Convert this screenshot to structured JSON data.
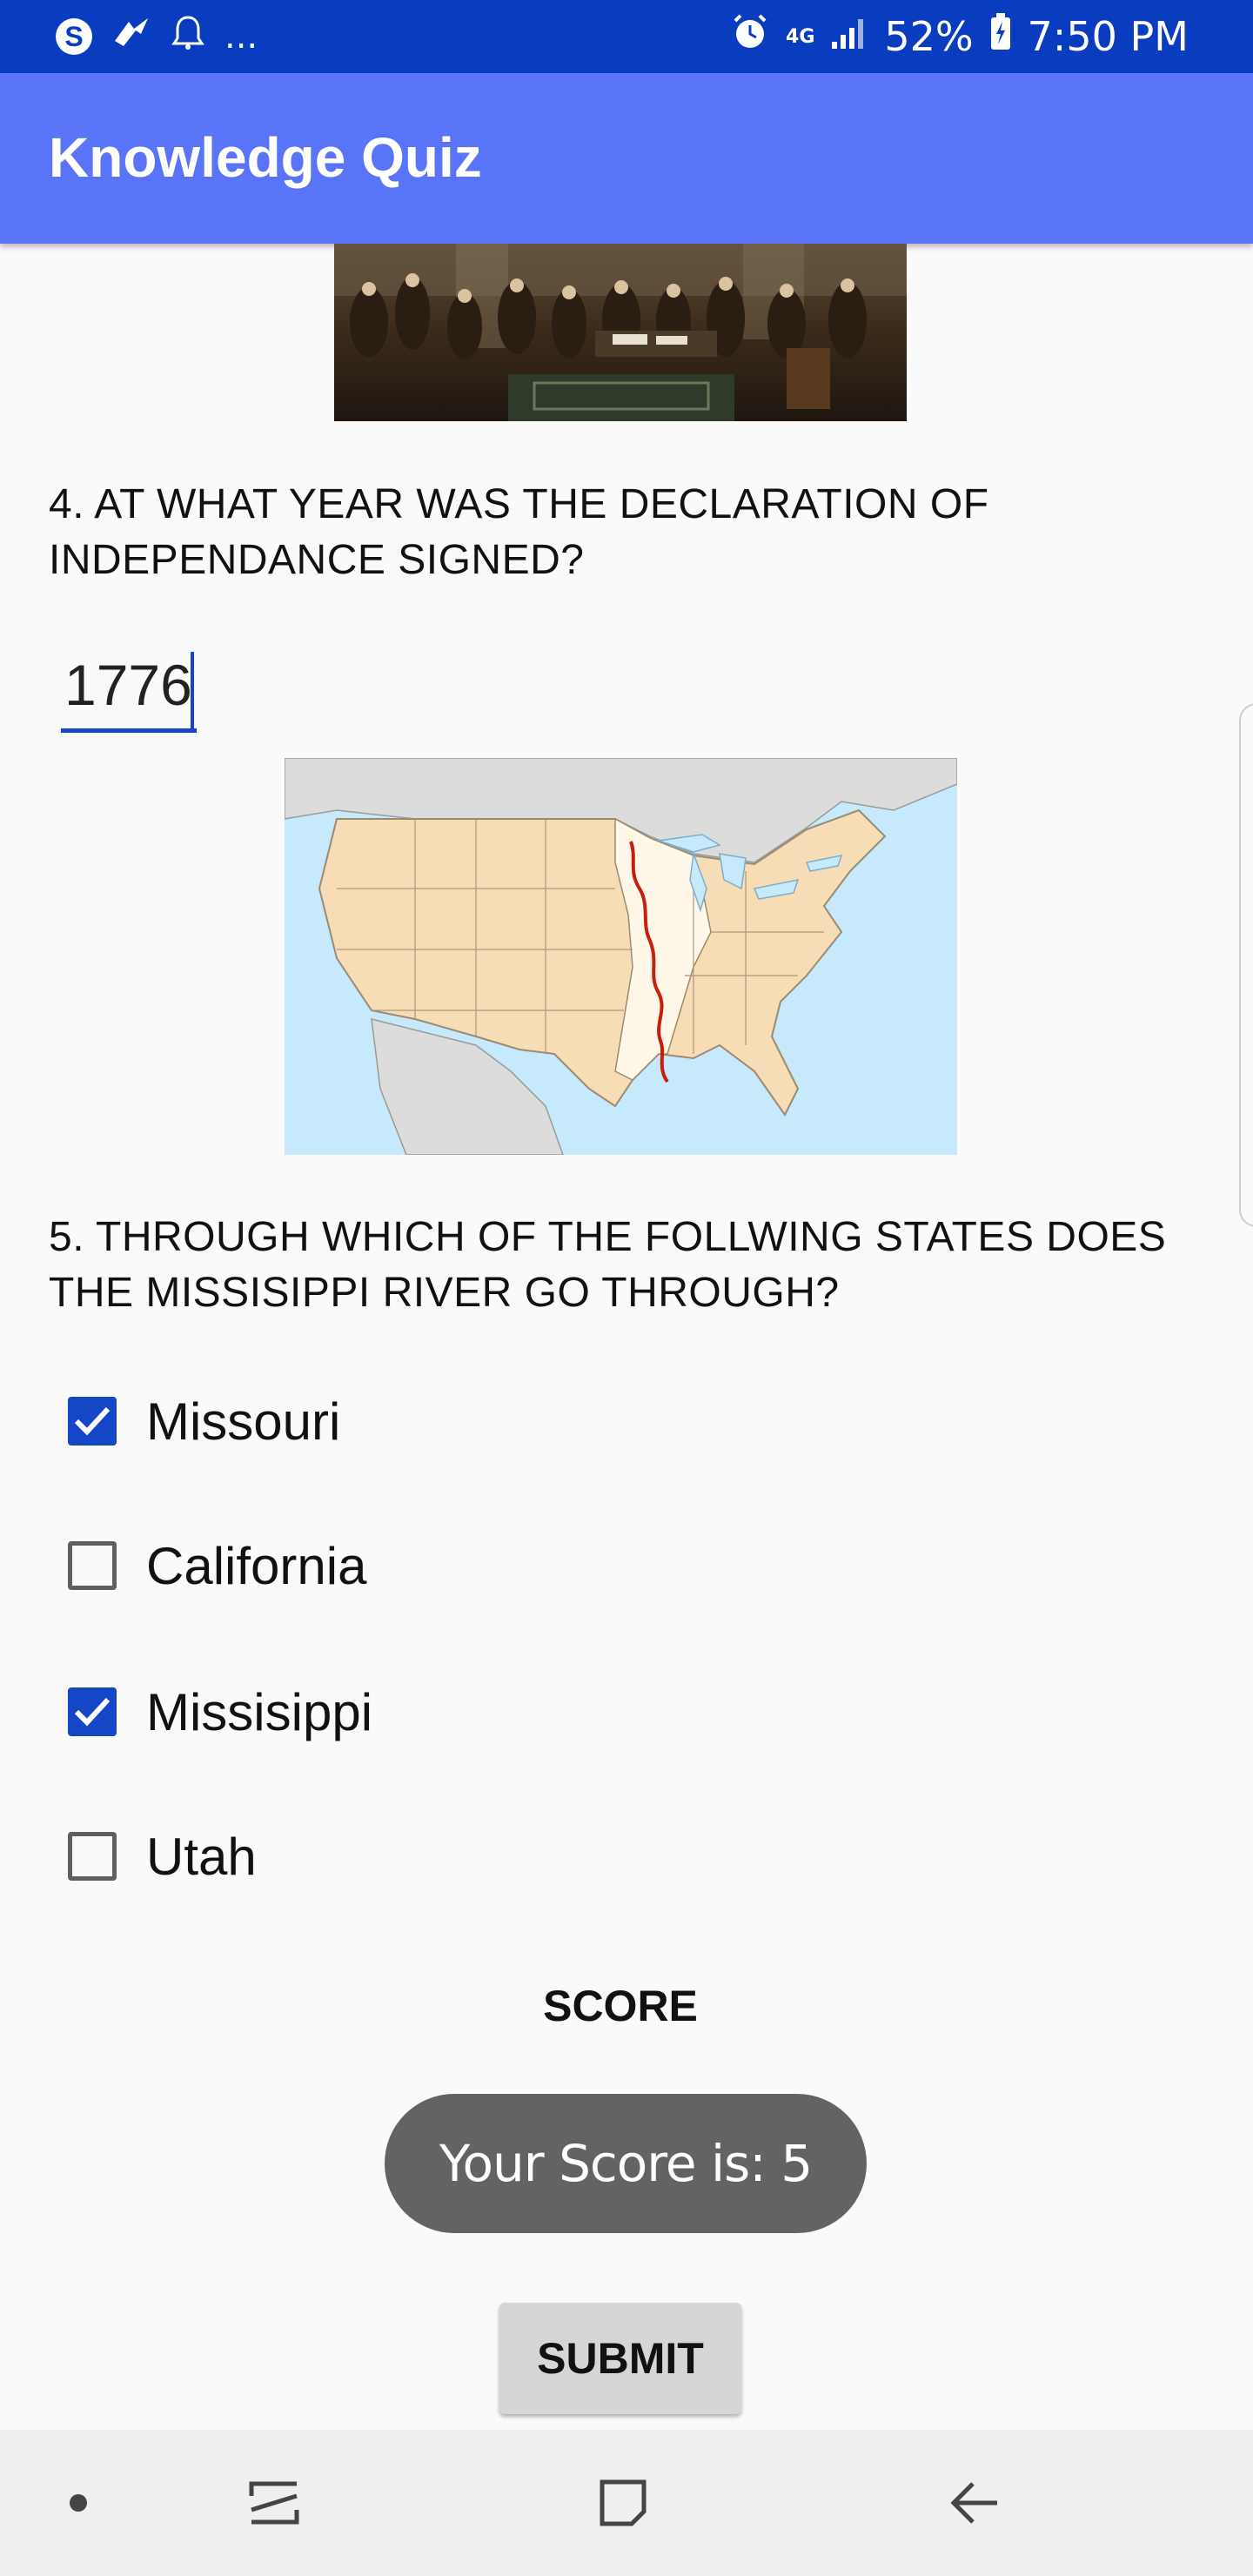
{
  "status_bar": {
    "notification_more": "...",
    "network": "4G",
    "battery": "52%",
    "time": "7:50 PM"
  },
  "app_bar": {
    "title": "Knowledge Quiz"
  },
  "questions": [
    {
      "text": "4. AT WHAT YEAR WAS THE DECLARATION OF INDEPENDANCE SIGNED?",
      "answer_value": "1776"
    },
    {
      "text": "5. THROUGH WHICH OF THE FOLLWING STATES DOES THE MISSISIPPI RIVER GO THROUGH?",
      "options": [
        {
          "label": "Missouri",
          "checked": true
        },
        {
          "label": "California",
          "checked": false
        },
        {
          "label": "Missisippi",
          "checked": true
        },
        {
          "label": "Utah",
          "checked": false
        }
      ]
    }
  ],
  "score": {
    "heading": "SCORE",
    "value": "5"
  },
  "toast": {
    "text": "Your Score is: 5"
  },
  "submit": {
    "label": "SUBMIT"
  },
  "colors": {
    "status_bar": "#0a3cc0",
    "app_bar": "#5a74f8",
    "accent": "#1646c8",
    "toast": "#636363"
  },
  "nav_bar": {
    "icons": [
      "dot-icon",
      "recent-apps-icon",
      "home-icon",
      "back-icon"
    ]
  }
}
